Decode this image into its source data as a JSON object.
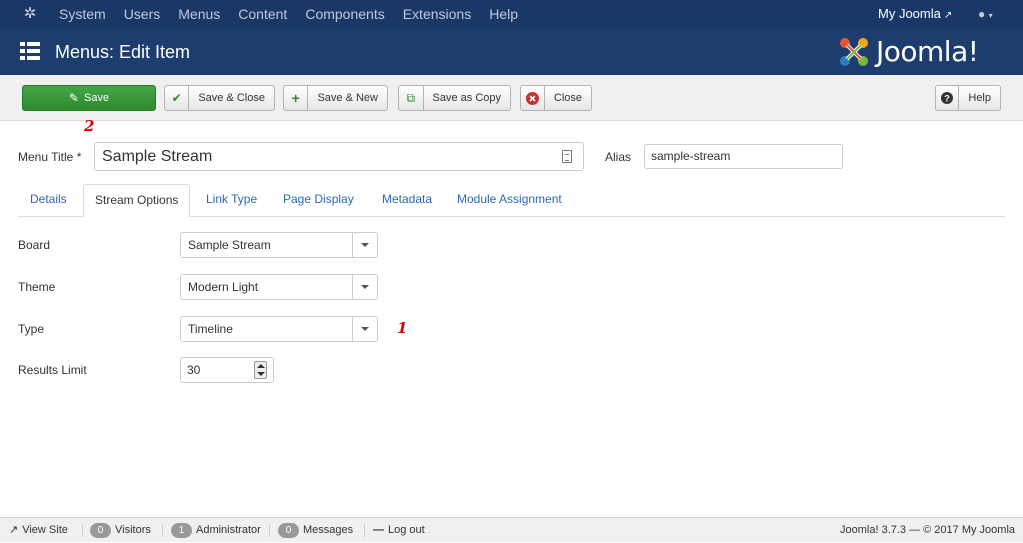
{
  "topbar": {
    "menu": [
      "System",
      "Users",
      "Menus",
      "Content",
      "Components",
      "Extensions",
      "Help"
    ],
    "site_link": "My Joomla",
    "user_icon": "user-icon"
  },
  "header": {
    "title": "Menus: Edit Item",
    "logo_text": "Joomla!",
    "brand_colors": [
      "#e8542f",
      "#f7a51b",
      "#7ab53c",
      "#2e7cbf"
    ]
  },
  "toolbar": {
    "save": "Save",
    "save_close": "Save & Close",
    "save_new": "Save & New",
    "save_copy": "Save as Copy",
    "close": "Close",
    "help": "Help"
  },
  "annotations": {
    "save_marker": "2",
    "type_marker": "1",
    "color": "#d40000"
  },
  "form": {
    "menu_title_label": "Menu Title *",
    "menu_title_value": "Sample Stream",
    "alias_label": "Alias",
    "alias_value": "sample-stream"
  },
  "tabs": [
    {
      "label": "Details",
      "active": false
    },
    {
      "label": "Stream Options",
      "active": true
    },
    {
      "label": "Link Type",
      "active": false
    },
    {
      "label": "Page Display",
      "active": false
    },
    {
      "label": "Metadata",
      "active": false
    },
    {
      "label": "Module Assignment",
      "active": false
    }
  ],
  "options": {
    "board_label": "Board",
    "board_value": "Sample Stream",
    "theme_label": "Theme",
    "theme_value": "Modern Light",
    "type_label": "Type",
    "type_value": "Timeline",
    "limit_label": "Results Limit",
    "limit_value": "30"
  },
  "statusbar": {
    "view_site": "View Site",
    "visitors_count": "0",
    "visitors_label": "Visitors",
    "admin_count": "1",
    "admin_label": "Administrator",
    "messages_count": "0",
    "messages_label": "Messages",
    "logout": "Log out",
    "copyright": "Joomla! 3.7.3  —  © 2017 My Joomla"
  }
}
